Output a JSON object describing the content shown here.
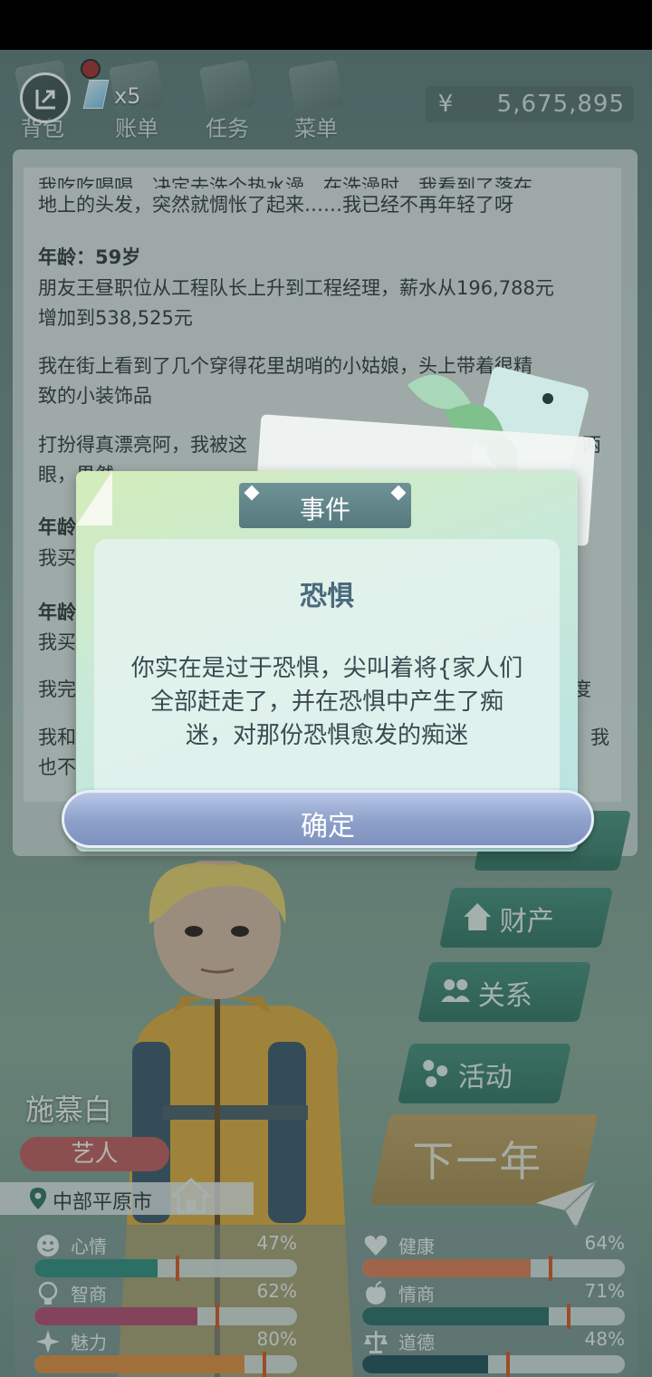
{
  "topbar": {
    "gem_count": "x5",
    "nav": [
      {
        "label": "背包"
      },
      {
        "label": "账单"
      },
      {
        "label": "任务"
      },
      {
        "label": "菜单"
      }
    ],
    "money_symbol": "¥",
    "money": "5,675,895"
  },
  "log": {
    "partial_line": "我吃吃喝喝，决定去洗个热水澡。在洗澡时，我看到了落在",
    "entries": [
      {
        "text": "地上的头发，突然就惆怅了起来……我已经不再年轻了呀"
      },
      {
        "age": "年龄：59岁"
      },
      {
        "text": "朋友王昼职位从工程队长上升到工程经理，薪水从196,788元"
      },
      {
        "text": "增加到538,525元"
      },
      {
        "text": "我在街上看到了几个穿得花里胡哨的小姑娘，头上带着很精"
      },
      {
        "text": "致的小装饰品"
      },
      {
        "text": "打扮得真漂亮阿，我被这"
      },
      {
        "text": "眼，果然"
      },
      {
        "age": "年龄"
      },
      {
        "text": "我买"
      },
      {
        "age": "年龄"
      },
      {
        "text": "我买"
      },
      {
        "text": "我完"
      },
      {
        "text": "我和"
      },
      {
        "text": "也不"
      }
    ],
    "right_fragments": {
      "line_a": "了两",
      "line_b": "度",
      "line_c": "我"
    }
  },
  "modal": {
    "header": "事件",
    "title": "恐惧",
    "description": "你实在是过于恐惧，尖叫着将{家人们全部赶走了，并在恐惧中产生了痴迷，对那份恐惧愈发的痴迷",
    "confirm": "确定"
  },
  "side_buttons": [
    {
      "label": "财产",
      "icon": "house-icon"
    },
    {
      "label": "关系",
      "icon": "people-icon"
    },
    {
      "label": "活动",
      "icon": "dots-icon"
    }
  ],
  "next_year": "下一年",
  "character": {
    "name": "施慕白",
    "profession": "艺人",
    "location": "中部平原市"
  },
  "stats": [
    {
      "label": "心情",
      "value": "47%",
      "fraction": 0.47,
      "color": "#2f8b7c",
      "icon": "smile-icon"
    },
    {
      "label": "健康",
      "value": "64%",
      "fraction": 0.64,
      "color": "#e07a52",
      "icon": "heart-icon"
    },
    {
      "label": "智商",
      "value": "62%",
      "fraction": 0.62,
      "color": "#b5486d",
      "icon": "bulb-icon"
    },
    {
      "label": "情商",
      "value": "71%",
      "fraction": 0.71,
      "color": "#2a6b64",
      "icon": "apple-icon"
    },
    {
      "label": "魅力",
      "value": "80%",
      "fraction": 0.8,
      "color": "#e08a3a",
      "icon": "sparkle-icon"
    },
    {
      "label": "道德",
      "value": "48%",
      "fraction": 0.48,
      "color": "#1f4e55",
      "icon": "scale-icon"
    }
  ]
}
